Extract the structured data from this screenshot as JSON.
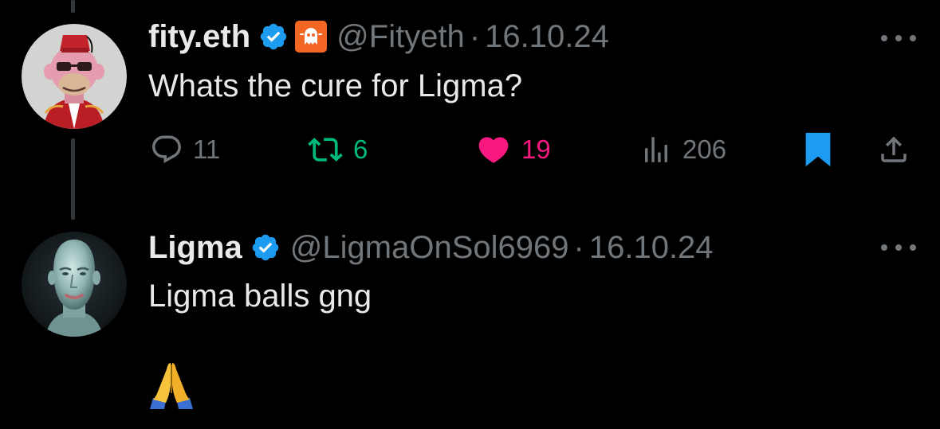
{
  "tweets": [
    {
      "display_name": "fity.eth",
      "handle": "@Fityeth",
      "separator": "·",
      "date": "16.10.24",
      "verified": true,
      "affiliate_badge": "ghost-logo-icon",
      "avatar": "bored-ape-avatar",
      "text": "Whats the cure for Ligma?",
      "actions": {
        "replies": "11",
        "reposts": "6",
        "likes": "19",
        "views": "206"
      },
      "liked": true,
      "bookmarked": true
    },
    {
      "display_name": "Ligma",
      "handle": "@LigmaOnSol6969",
      "separator": "·",
      "date": "16.10.24",
      "verified": true,
      "avatar": "pale-humanoid-avatar",
      "text": "Ligma balls gng",
      "emoji": "folded-hands-emoji"
    }
  ],
  "colors": {
    "background": "#000000",
    "text_primary": "#e7e9ea",
    "text_secondary": "#71767b",
    "verified_blue": "#1d9bf0",
    "repost_green": "#00ba7c",
    "like_pink": "#f91880",
    "bookmark_blue": "#1d9bf0",
    "affiliate_orange": "#f26522",
    "thread_line": "#333639"
  }
}
